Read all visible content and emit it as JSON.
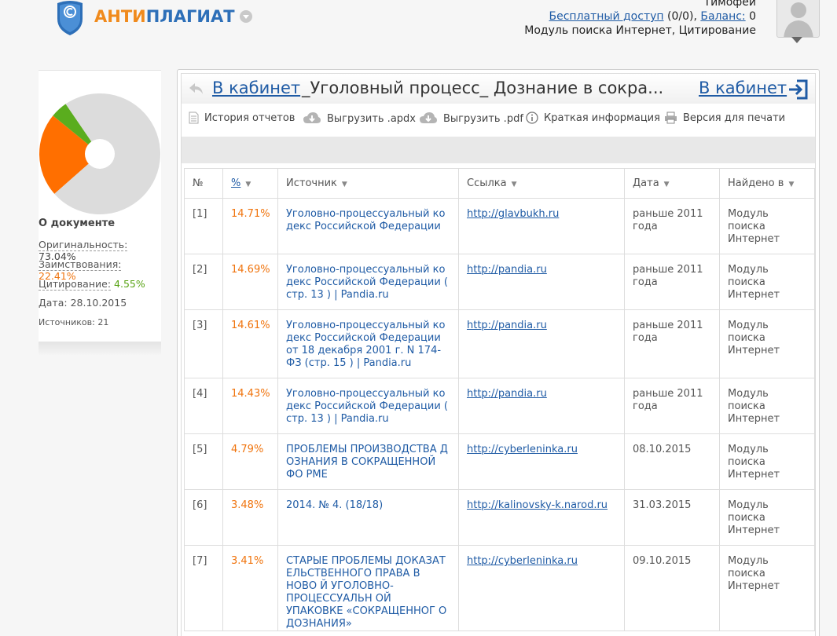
{
  "header": {
    "logo": {
      "part1": "АНТИ",
      "part2": "ПЛАГИАТ"
    },
    "user_name": "Тимофей",
    "free_access_link": "Бесплатный доступ",
    "free_access_count": " (0/0), ",
    "balance_link": "Баланс:",
    "balance_value": " 0",
    "modules": "Модуль поиска Интернет, Цитирование"
  },
  "sidebar": {
    "title": "О документе",
    "originality_label": "Оригинальность:",
    "originality_value": "73.04%",
    "borrowing_label": "Заимствования:",
    "borrowing_value": "22.41%",
    "citation_label": "Цитирование:",
    "citation_value": "4.55%",
    "date_label": "Дата:",
    "date_value": "28.10.2015",
    "sources_label": "Источников:",
    "sources_value": "21",
    "pie_data": [
      {
        "name": "Оригинальность",
        "value": 73.04,
        "color": "#dcdcdc"
      },
      {
        "name": "Заимствования",
        "value": 22.41,
        "color": "#ff6f00"
      },
      {
        "name": "Цитирование",
        "value": 4.55,
        "color": "#5aad1e"
      }
    ]
  },
  "panel": {
    "cabinet_link_left": "В кабинет",
    "doc_title": "_Уголовный процесс_ Дознание в сокра...",
    "cabinet_link_right": "В кабинет",
    "toolbar": {
      "history": "История отчетов",
      "export_apdx": "Выгрузить .apdx",
      "export_pdf": "Выгрузить .pdf",
      "brief_info": "Краткая информация",
      "print_version": "Версия для печати"
    }
  },
  "table": {
    "headers": {
      "num": "№",
      "pct": "%",
      "source": "Источник",
      "link": "Ссылка",
      "date": "Дата",
      "found": "Найдено в"
    },
    "rows": [
      {
        "num": "[1]",
        "pct": "14.71%",
        "source": "Уголовно-процессуальный ко декс Российской Федерации",
        "link": "http://glavbukh.ru",
        "date": "раньше 2011 года",
        "found": "Модуль поиска Интернет"
      },
      {
        "num": "[2]",
        "pct": "14.69%",
        "source": "Уголовно-процессуальный ко декс Российской Федерации ( стр. 13 ) | Pandia.ru",
        "link": "http://pandia.ru",
        "date": "раньше 2011 года",
        "found": "Модуль поиска Интернет"
      },
      {
        "num": "[3]",
        "pct": "14.61%",
        "source": "Уголовно-процессуальный ко декс Российской Федерации от 18 декабря 2001 г. N 174-ФЗ (стр. 15 ) | Pandia.ru",
        "link": "http://pandia.ru",
        "date": "раньше 2011 года",
        "found": "Модуль поиска Интернет"
      },
      {
        "num": "[4]",
        "pct": "14.43%",
        "source": "Уголовно-процессуальный ко декс Российской Федерации ( стр. 13 ) | Pandia.ru",
        "link": "http://pandia.ru",
        "date": "раньше 2011 года",
        "found": "Модуль поиска Интернет"
      },
      {
        "num": "[5]",
        "pct": "4.79%",
        "source": "ПРОБЛЕМЫ ПРОИЗВОДСТВА Д ОЗНАНИЯ В СОКРАЩЕННОЙ ФО РМЕ",
        "link": "http://cyberleninka.ru",
        "date": "08.10.2015",
        "found": "Модуль поиска Интернет"
      },
      {
        "num": "[6]",
        "pct": "3.48%",
        "source": "2014. № 4. (18/18)",
        "link": "http://kalinovsky-k.narod.ru",
        "date": "31.03.2015",
        "found": "Модуль поиска Интернет"
      },
      {
        "num": "[7]",
        "pct": "3.41%",
        "source": "СТАРЫЕ ПРОБЛЕМЫ ДОКАЗАТ ЕЛЬСТВЕННОГО ПРАВА В НОВО Й УГОЛОВНО-ПРОЦЕССУАЛЬН ОЙ УПАКОВКЕ «СОКРАЩЕННОГ О ДОЗНАНИЯ»",
        "link": "http://cyberleninka.ru",
        "date": "09.10.2015",
        "found": "Модуль поиска Интернет"
      }
    ]
  }
}
